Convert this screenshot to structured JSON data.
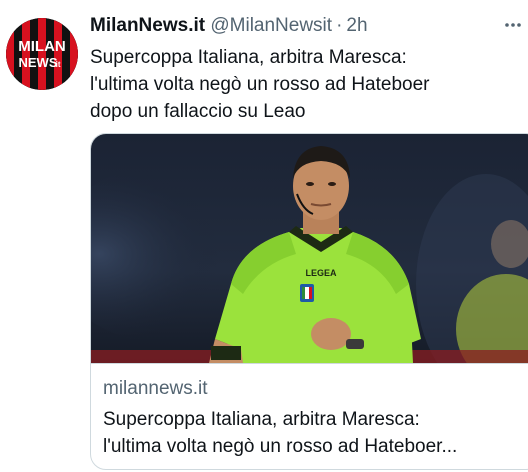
{
  "tweet": {
    "display_name": "MilanNews.it",
    "handle": "@MilanNewsit",
    "separator": "·",
    "time": "2h",
    "text_lines": [
      "Supercoppa Italiana, arbitra Maresca:",
      "l'ultima volta negò un rosso ad Hateboer",
      "dopo un fallaccio su Leao"
    ]
  },
  "avatar": {
    "logo_top": "MILAN",
    "logo_bottom": "NEWS",
    "logo_suffix": ".it"
  },
  "card": {
    "shirt_text": "LEGEA",
    "domain": "milannews.it",
    "title_lines": [
      "Supercoppa Italiana, arbitra Maresca:",
      "l'ultima volta negò un rosso ad Hateboer..."
    ]
  },
  "icons": {
    "more": "more-options-icon"
  },
  "colors": {
    "text": "#0f1419",
    "secondary": "#536471",
    "border": "#cfd9de",
    "milan_red": "#d7111f",
    "referee_shirt": "#9be23c"
  }
}
